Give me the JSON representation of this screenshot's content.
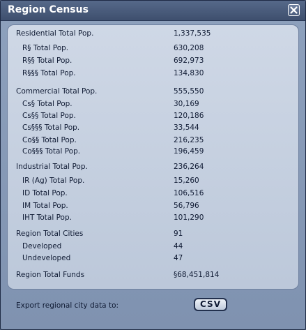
{
  "window": {
    "title": "Region Census",
    "close_icon": "close-icon"
  },
  "stats": {
    "residential": {
      "label": "Residential Total Pop.",
      "value": "1,337,535",
      "items": [
        {
          "label": "R§ Total Pop.",
          "value": "630,208"
        },
        {
          "label": "R§§ Total Pop.",
          "value": "692,973"
        },
        {
          "label": "R§§§ Total Pop.",
          "value": "134,830"
        }
      ]
    },
    "commercial": {
      "label": "Commercial Total Pop.",
      "value": "555,550",
      "items": [
        {
          "label": "Cs§ Total Pop.",
          "value": "30,169"
        },
        {
          "label": "Cs§§ Total Pop.",
          "value": "120,186"
        },
        {
          "label": "Cs§§§ Total Pop.",
          "value": "33,544"
        },
        {
          "label": "Co§§ Total Pop.",
          "value": "216,235"
        },
        {
          "label": "Co§§§ Total Pop.",
          "value": "196,459"
        }
      ]
    },
    "industrial": {
      "label": "Industrial Total Pop.",
      "value": "236,264",
      "items": [
        {
          "label": "IR (Ag) Total Pop.",
          "value": "15,260"
        },
        {
          "label": "ID Total Pop.",
          "value": "106,516"
        },
        {
          "label": "IM Total Pop.",
          "value": "56,796"
        },
        {
          "label": "IHT Total Pop.",
          "value": "101,290"
        }
      ]
    },
    "cities": {
      "label": "Region Total Cities",
      "value": "91",
      "items": [
        {
          "label": "Developed",
          "value": "44"
        },
        {
          "label": "Undeveloped",
          "value": "47"
        }
      ]
    },
    "funds": {
      "label": "Region Total Funds",
      "value": "§68,451,814"
    }
  },
  "footer": {
    "export_label": "Export regional city data to:",
    "csv_button": "CSV"
  }
}
